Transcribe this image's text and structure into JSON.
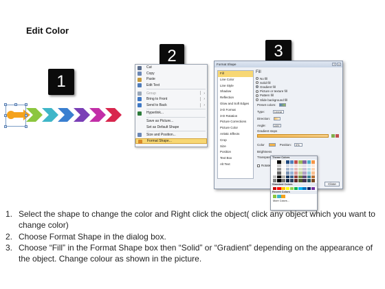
{
  "page": {
    "title": "Edit Color"
  },
  "steps": [
    "1",
    "2",
    "3"
  ],
  "arrows": {
    "colors": [
      "#f4a21c",
      "#8cc63f",
      "#3fb6c8",
      "#3a7fd0",
      "#7a3fb6",
      "#c22fa8",
      "#d8264d"
    ]
  },
  "context_menu": {
    "items": [
      {
        "label": "Cut",
        "icon": "scissors-icon",
        "color": "#5b6d8c"
      },
      {
        "label": "Copy",
        "icon": "copy-icon",
        "color": "#6b87b4"
      },
      {
        "label": "Paste",
        "icon": "paste-icon",
        "color": "#c59b3d"
      },
      {
        "label": "Edit Text",
        "icon": "edit-text-icon",
        "color": "#4f7bb8"
      },
      {
        "label": "Group",
        "icon": "group-icon",
        "color": "#9aa7b8",
        "disabled": true,
        "submenu": true
      },
      {
        "label": "Bring to Front",
        "icon": "bring-front-icon",
        "color": "#3f78c4",
        "submenu": true
      },
      {
        "label": "Send to Back",
        "icon": "send-back-icon",
        "color": "#3f78c4",
        "submenu": true
      },
      {
        "label": "Hyperlink...",
        "icon": "hyperlink-icon",
        "color": "#2c7b3a"
      },
      {
        "label": "Save as Picture...",
        "icon": "",
        "color": ""
      },
      {
        "label": "Set as Default Shape",
        "icon": "",
        "color": ""
      },
      {
        "label": "Size and Position...",
        "icon": "size-icon",
        "color": "#6b87b4"
      },
      {
        "label": "Format Shape...",
        "icon": "format-shape-icon",
        "color": "#d88a2a",
        "highlight": true
      }
    ]
  },
  "dialog": {
    "title": "Format Shape",
    "nav": [
      "Fill",
      "Line Color",
      "Line Style",
      "Shadow",
      "Reflection",
      "Glow and Soft Edges",
      "3-D Format",
      "3-D Rotation",
      "Picture Corrections",
      "Picture Color",
      "Artistic Effects",
      "Crop",
      "Size",
      "Position",
      "Text Box",
      "Alt Text"
    ],
    "panel_heading": "Fill",
    "fill_options": [
      "No fill",
      "Solid fill",
      "Gradient fill",
      "Picture or texture fill",
      "Pattern fill",
      "Slide background fill"
    ],
    "selected_fill": "Gradient fill",
    "labels": {
      "preset": "Preset colors:",
      "type": "Type:",
      "type_value": "Linear",
      "direction": "Direction:",
      "angle": "Angle:",
      "angle_value": "225°",
      "gradient_stops": "Gradient stops",
      "color": "Color",
      "position": "Position:",
      "position_value": "0%",
      "brightness": "Brightness",
      "transparency": "Transparency",
      "rotate": "Rotate w",
      "close": "Close"
    }
  },
  "palette": {
    "theme_heading": "Theme Colors",
    "standard_heading": "Standard Colors",
    "recent_heading": "Recent Colors",
    "more_label": "More Colors...",
    "theme_top": [
      "#ffffff",
      "#000000",
      "#eeece1",
      "#1f497d",
      "#4f81bd",
      "#c0504d",
      "#9bbb59",
      "#8064a2",
      "#4bacc6",
      "#f79646"
    ],
    "standard": [
      "#c00000",
      "#ff0000",
      "#ffc000",
      "#ffff00",
      "#92d050",
      "#00b050",
      "#00b0f0",
      "#0070c0",
      "#002060",
      "#7030a0"
    ],
    "recent": [
      "#8cc63f",
      "#3fb6c8",
      "#f4a21c"
    ]
  },
  "instructions": [
    {
      "num": "1.",
      "text": "Select the shape to change the color and Right click the object( click any object which you want to change color)"
    },
    {
      "num": "2.",
      "text": "Choose Format Shape in the dialog box."
    },
    {
      "num": "3.",
      "text": "Choose “Fill” in the Format Shape box then “Solid” or “Gradient” depending on the appearance of the object. Change colour as shown in the picture."
    }
  ]
}
